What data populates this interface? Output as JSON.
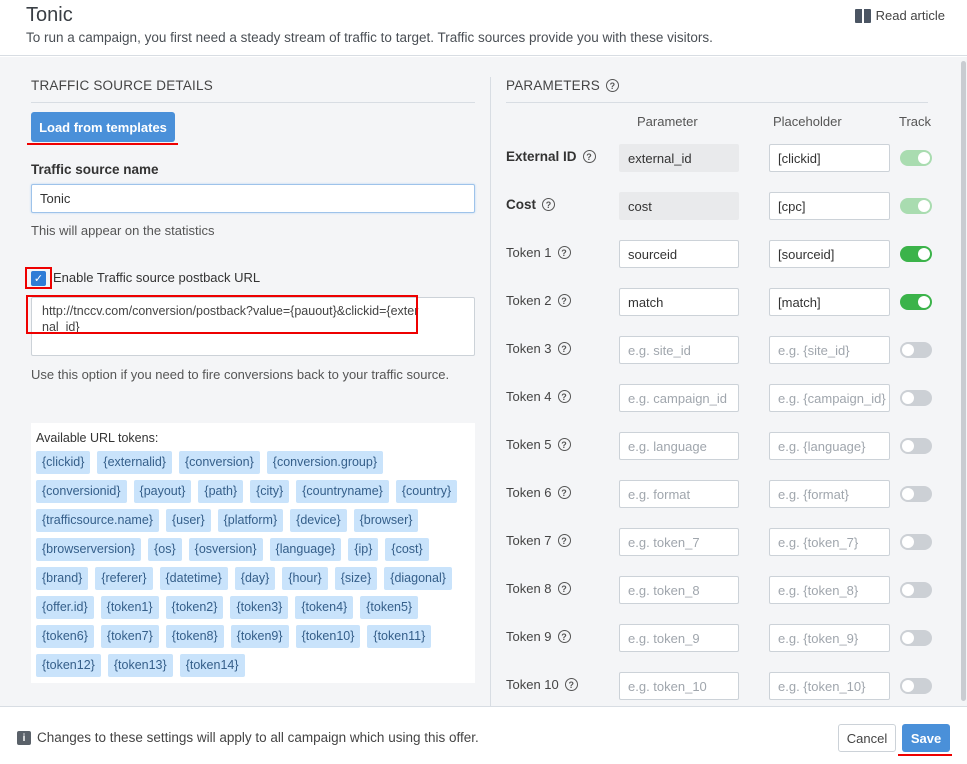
{
  "header": {
    "title": "Tonic",
    "subtitle": "To run a campaign, you first need a steady stream of traffic to target. Traffic sources provide you with these visitors.",
    "read_article": "Read article"
  },
  "left": {
    "section_title": "TRAFFIC SOURCE DETAILS",
    "load_templates_label": "Load from templates",
    "name_label": "Traffic source name",
    "name_value": "Tonic",
    "name_helper": "This will appear on the statistics",
    "postback_checkbox_label": "Enable Traffic source postback URL",
    "postback_checked": true,
    "postback_url": "http://tnccv.com/conversion/postback?value={pauout}&clickid={external_id}",
    "postback_helper": "Use this option if you need to fire conversions back to your traffic source.",
    "tokens_title": "Available URL tokens:",
    "tokens": [
      "{clickid}",
      "{externalid}",
      "{conversion}",
      "{conversion.group}",
      "{conversionid}",
      "{payout}",
      "{path}",
      "{city}",
      "{countryname}",
      "{country}",
      "{trafficsource.name}",
      "{user}",
      "{platform}",
      "{device}",
      "{browser}",
      "{browserversion}",
      "{os}",
      "{osversion}",
      "{language}",
      "{ip}",
      "{cost}",
      "{brand}",
      "{referer}",
      "{datetime}",
      "{day}",
      "{hour}",
      "{size}",
      "{diagonal}",
      "{offer.id}",
      "{token1}",
      "{token2}",
      "{token3}",
      "{token4}",
      "{token5}",
      "{token6}",
      "{token7}",
      "{token8}",
      "{token9}",
      "{token10}",
      "{token11}",
      "{token12}",
      "{token13}",
      "{token14}"
    ]
  },
  "right": {
    "section_title": "PARAMETERS",
    "col_parameter": "Parameter",
    "col_placeholder": "Placeholder",
    "col_track": "Track",
    "rows": [
      {
        "label": "External ID",
        "param": "external_id",
        "param_placeholder": "",
        "placeholder": "[clickid]",
        "placeholder_hint": "",
        "track": true
      },
      {
        "label": "Cost",
        "param": "cost",
        "param_placeholder": "",
        "placeholder": "[cpc]",
        "placeholder_hint": "",
        "track": true
      },
      {
        "label": "Token 1",
        "param": "sourceid",
        "param_placeholder": "",
        "placeholder": "[sourceid]",
        "placeholder_hint": "",
        "track": true
      },
      {
        "label": "Token 2",
        "param": "match",
        "param_placeholder": "",
        "placeholder": "[match]",
        "placeholder_hint": "",
        "track": true
      },
      {
        "label": "Token 3",
        "param": "",
        "param_placeholder": "e.g. site_id",
        "placeholder": "",
        "placeholder_hint": "e.g. {site_id}",
        "track": false
      },
      {
        "label": "Token 4",
        "param": "",
        "param_placeholder": "e.g. campaign_id",
        "placeholder": "",
        "placeholder_hint": "e.g. {campaign_id}",
        "track": false
      },
      {
        "label": "Token 5",
        "param": "",
        "param_placeholder": "e.g. language",
        "placeholder": "",
        "placeholder_hint": "e.g. {language}",
        "track": false
      },
      {
        "label": "Token 6",
        "param": "",
        "param_placeholder": "e.g. format",
        "placeholder": "",
        "placeholder_hint": "e.g. {format}",
        "track": false
      },
      {
        "label": "Token 7",
        "param": "",
        "param_placeholder": "e.g. token_7",
        "placeholder": "",
        "placeholder_hint": "e.g. {token_7}",
        "track": false
      },
      {
        "label": "Token 8",
        "param": "",
        "param_placeholder": "e.g. token_8",
        "placeholder": "",
        "placeholder_hint": "e.g. {token_8}",
        "track": false
      },
      {
        "label": "Token 9",
        "param": "",
        "param_placeholder": "e.g. token_9",
        "placeholder": "",
        "placeholder_hint": "e.g. {token_9}",
        "track": false
      },
      {
        "label": "Token 10",
        "param": "",
        "param_placeholder": "e.g. token_10",
        "placeholder": "",
        "placeholder_hint": "e.g. {token_10}",
        "track": false
      }
    ]
  },
  "footer": {
    "info_text": "Changes to these settings will apply to all campaign which using this offer.",
    "cancel_label": "Cancel",
    "save_label": "Save"
  },
  "colors": {
    "primary": "#4a90d9",
    "toggle_on": "#3bb34a",
    "annotation_red": "#e00000",
    "token_tag_bg": "#c9e3fb"
  }
}
